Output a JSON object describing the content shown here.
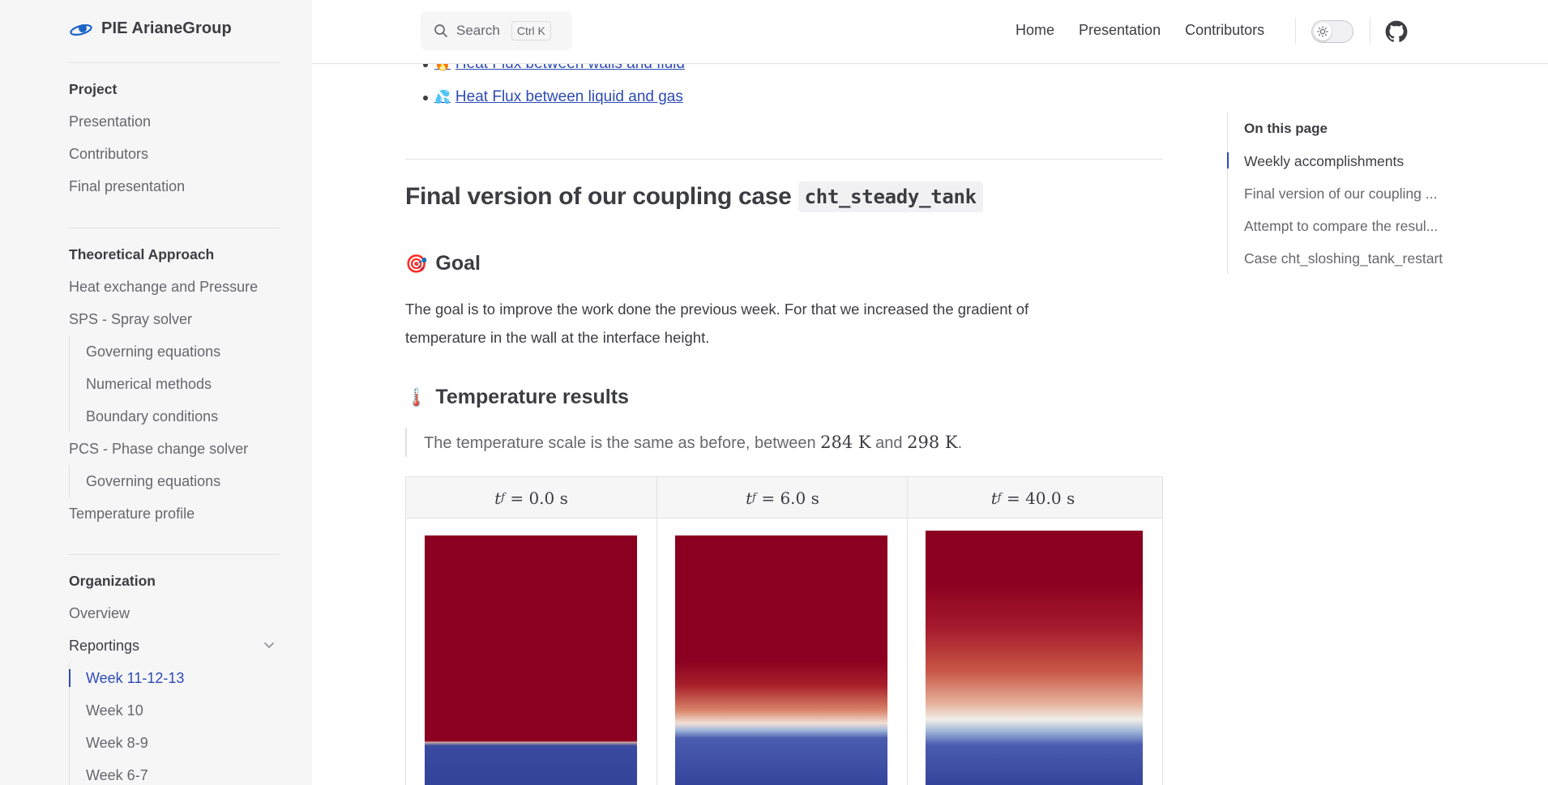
{
  "brand": {
    "name": "PIE ArianeGroup"
  },
  "search": {
    "label": "Search",
    "shortcut": "Ctrl K"
  },
  "nav": {
    "home": "Home",
    "presentation": "Presentation",
    "contributors": "Contributors"
  },
  "sidebar": {
    "project": {
      "title": "Project",
      "items": [
        "Presentation",
        "Contributors",
        "Final presentation"
      ]
    },
    "theory": {
      "title": "Theoretical Approach",
      "items": {
        "heat": "Heat exchange and Pressure",
        "sps": "SPS - Spray solver",
        "sps_sub": [
          "Governing equations",
          "Numerical methods",
          "Boundary conditions"
        ],
        "pcs": "PCS - Phase change solver",
        "pcs_sub": [
          "Governing equations"
        ],
        "temp": "Temperature profile"
      }
    },
    "organization": {
      "title": "Organization",
      "overview": "Overview",
      "reportings": "Reportings",
      "weeks": [
        "Week 11-12-13",
        "Week 10",
        "Week 8-9",
        "Week 6-7"
      ]
    }
  },
  "content": {
    "bullets": [
      {
        "emoji": "🔥",
        "text": "Heat Flux between walls and fluid"
      },
      {
        "emoji": "💦",
        "text": "Heat Flux between liquid and gas"
      }
    ],
    "h2_text": "Final version of our coupling case",
    "h2_code": "cht_steady_tank",
    "goal": {
      "emoji": "🎯",
      "title": "Goal"
    },
    "goal_text": "The goal is to improve the work done the previous week. For that we increased the gradient of temperature in the wall at the interface height.",
    "temp": {
      "emoji": "🌡️",
      "title": "Temperature results"
    },
    "quote": {
      "prefix": "The temperature scale is the same as before, between",
      "v1": "284 K",
      "and": "and",
      "v2": "298 K",
      "suffix": "."
    },
    "table_headers": [
      {
        "var": "t",
        "sub": "f",
        "rest": " = 0.0 s"
      },
      {
        "var": "t",
        "sub": "f",
        "rest": " = 6.0 s"
      },
      {
        "var": "t",
        "sub": "f",
        "rest": " = 40.0 s"
      }
    ]
  },
  "toc": {
    "title": "On this page",
    "items": [
      "Weekly accomplishments",
      "Final version of our coupling ...",
      "Attempt to compare the resul...",
      "Case cht_sloshing_tank_restart"
    ]
  },
  "colors": {
    "accent": "#2d4bb3",
    "hot": "#8b0020",
    "cold": "#3a4aa0"
  }
}
